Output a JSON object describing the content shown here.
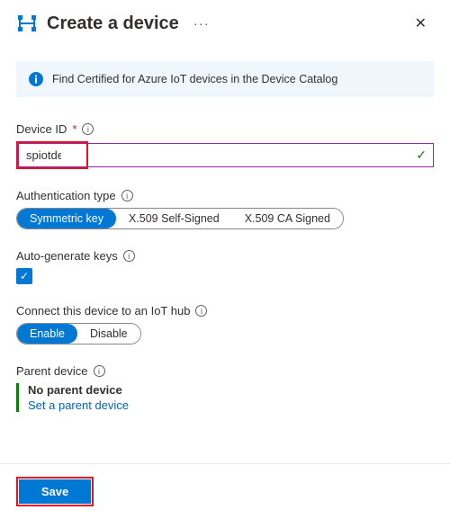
{
  "header": {
    "title": "Create a device"
  },
  "banner": {
    "text": "Find Certified for Azure IoT devices in the Device Catalog"
  },
  "deviceId": {
    "label": "Device ID",
    "value": "spiotdevice"
  },
  "authType": {
    "label": "Authentication type",
    "options": [
      "Symmetric key",
      "X.509 Self-Signed",
      "X.509 CA Signed"
    ],
    "selected": 0
  },
  "autoGen": {
    "label": "Auto-generate keys",
    "checked": true
  },
  "connect": {
    "label": "Connect this device to an IoT hub",
    "options": [
      "Enable",
      "Disable"
    ],
    "selected": 0
  },
  "parent": {
    "label": "Parent device",
    "noneText": "No parent device",
    "linkText": "Set a parent device"
  },
  "footer": {
    "saveLabel": "Save"
  },
  "icons": {
    "more": "···",
    "close": "✕",
    "help": "i",
    "check": "✓"
  }
}
